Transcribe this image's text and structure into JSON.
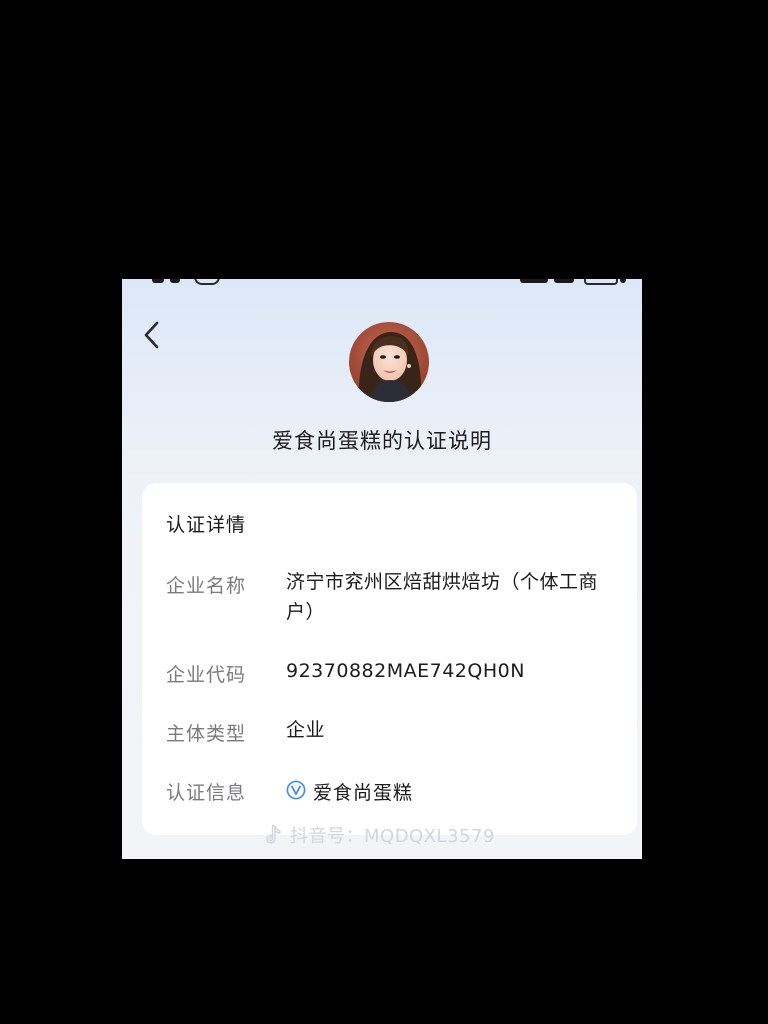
{
  "header": {
    "back_icon": "chevron-left-icon",
    "title": "爱食尚蛋糕的认证说明"
  },
  "card": {
    "title": "认证详情",
    "rows": [
      {
        "label": "企业名称",
        "value": "济宁市兖州区焙甜烘焙坊（个体工商户）"
      },
      {
        "label": "企业代码",
        "value": "92370882MAE742QH0N"
      },
      {
        "label": "主体类型",
        "value": "企业"
      },
      {
        "label": "认证信息",
        "value": "爱食尚蛋糕",
        "icon": "verified-v-icon"
      }
    ]
  },
  "watermark": {
    "icon": "tiktok-icon",
    "text": "抖音号：MQDQXL3579"
  },
  "colors": {
    "background": "#000000",
    "card": "#ffffff",
    "label": "#7a7a80",
    "text": "#1c1c1e",
    "verify_blue": "#3b8bf0"
  }
}
